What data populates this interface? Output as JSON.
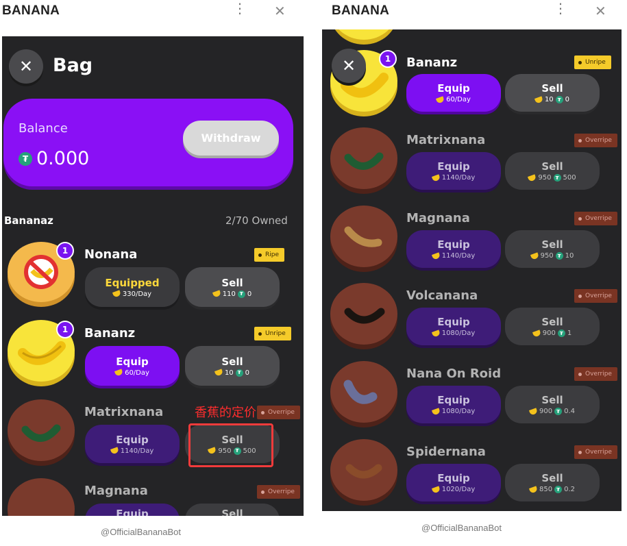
{
  "app_title": "BANANA",
  "footer": "@OfficialBananaBot",
  "left": {
    "bag_title": "Bag",
    "balance_label": "Balance",
    "balance_value": "0.000",
    "withdraw": "Withdraw",
    "section_title": "Bananaz",
    "owned_count": "2/70 Owned",
    "annotation": "香蕉的定价",
    "items": [
      {
        "name": "Nonana",
        "tag": "Ripe",
        "badge": "1",
        "equip": "Equipped",
        "rate": "330/Day",
        "sell": "Sell",
        "sell_banana": "110",
        "sell_tether": "0"
      },
      {
        "name": "Bananz",
        "tag": "Unripe",
        "badge": "1",
        "equip": "Equip",
        "rate": "60/Day",
        "sell": "Sell",
        "sell_banana": "10",
        "sell_tether": "0"
      },
      {
        "name": "Matrixnana",
        "tag": "Overripe",
        "equip": "Equip",
        "rate": "1140/Day",
        "sell": "Sell",
        "sell_banana": "950",
        "sell_tether": "500"
      },
      {
        "name": "Magnana",
        "tag": "Overripe",
        "equip": "Equip",
        "sell": "Sell"
      }
    ]
  },
  "right": {
    "items": [
      {
        "name": "Bananz",
        "tag": "Unripe",
        "badge": "1",
        "equip": "Equip",
        "rate": "60/Day",
        "sell": "Sell",
        "sell_banana": "10",
        "sell_tether": "0"
      },
      {
        "name": "Matrixnana",
        "tag": "Overripe",
        "equip": "Equip",
        "rate": "1140/Day",
        "sell": "Sell",
        "sell_banana": "950",
        "sell_tether": "500"
      },
      {
        "name": "Magnana",
        "tag": "Overripe",
        "equip": "Equip",
        "rate": "1140/Day",
        "sell": "Sell",
        "sell_banana": "950",
        "sell_tether": "10"
      },
      {
        "name": "Volcanana",
        "tag": "Overripe",
        "equip": "Equip",
        "rate": "1080/Day",
        "sell": "Sell",
        "sell_banana": "900",
        "sell_tether": "1"
      },
      {
        "name": "Nana On Roid",
        "tag": "Overripe",
        "equip": "Equip",
        "rate": "1080/Day",
        "sell": "Sell",
        "sell_banana": "900",
        "sell_tether": "0.4"
      },
      {
        "name": "Spidernana",
        "tag": "Overripe",
        "equip": "Equip",
        "rate": "1020/Day",
        "sell": "Sell",
        "sell_banana": "850",
        "sell_tether": "0.2"
      }
    ]
  },
  "colors": {
    "accent": "#8a10f5",
    "tether": "#26a17b",
    "ripe_tag": "#f5cb2a",
    "overripe_tag": "#7a3423",
    "annotation": "#ff2d2d"
  },
  "icons": {
    "menu": "vertical-dots-icon",
    "close": "close-icon",
    "tether": "tether-icon",
    "banana": "banana-icon"
  }
}
